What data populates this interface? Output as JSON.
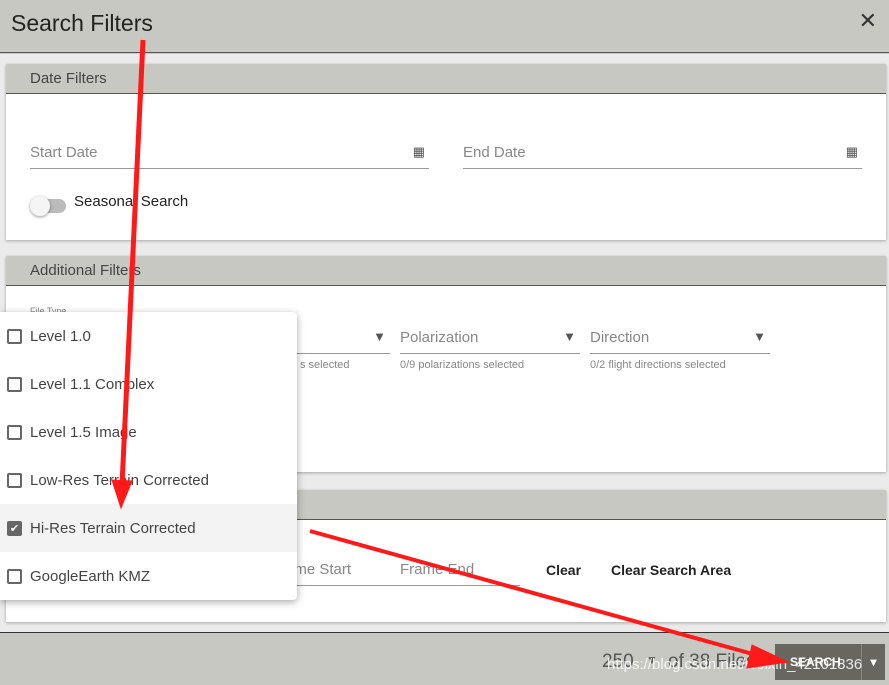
{
  "dialog": {
    "title": "Search Filters",
    "close_icon": "close-icon"
  },
  "date_filters": {
    "header": "Date Filters",
    "start_date": "Start Date",
    "end_date": "End Date",
    "calendar_icon": "calendar-icon",
    "seasonal": "Seasonal Search"
  },
  "additional_filters": {
    "header": "Additional Filters",
    "file_type_label": "File Type",
    "file_type_hint": "s selected",
    "polarization": "Polarization",
    "polarization_hint": "0/9 polarizations selected",
    "direction": "Direction",
    "direction_hint": "0/2 flight directions selected"
  },
  "path_frame": {
    "frame_start": "ame Start",
    "frame_end": "Frame End",
    "clear": "Clear",
    "clear_area": "Clear Search Area"
  },
  "file_type_menu": [
    {
      "label": "Level 1.0",
      "checked": false
    },
    {
      "label": "Level 1.1 Complex",
      "checked": false
    },
    {
      "label": "Level 1.5 Image",
      "checked": false
    },
    {
      "label": "Low-Res Terrain Corrected",
      "checked": false
    },
    {
      "label": "Hi-Res Terrain Corrected",
      "checked": true
    },
    {
      "label": "GoogleEarth KMZ",
      "checked": false
    }
  ],
  "footer": {
    "max_results": "250",
    "of_files": "of 38 Files",
    "search": "SEARCH"
  },
  "watermark": "https://blog.csdn.net/weixin_42101836",
  "annotation_color": "#ff1a1a"
}
